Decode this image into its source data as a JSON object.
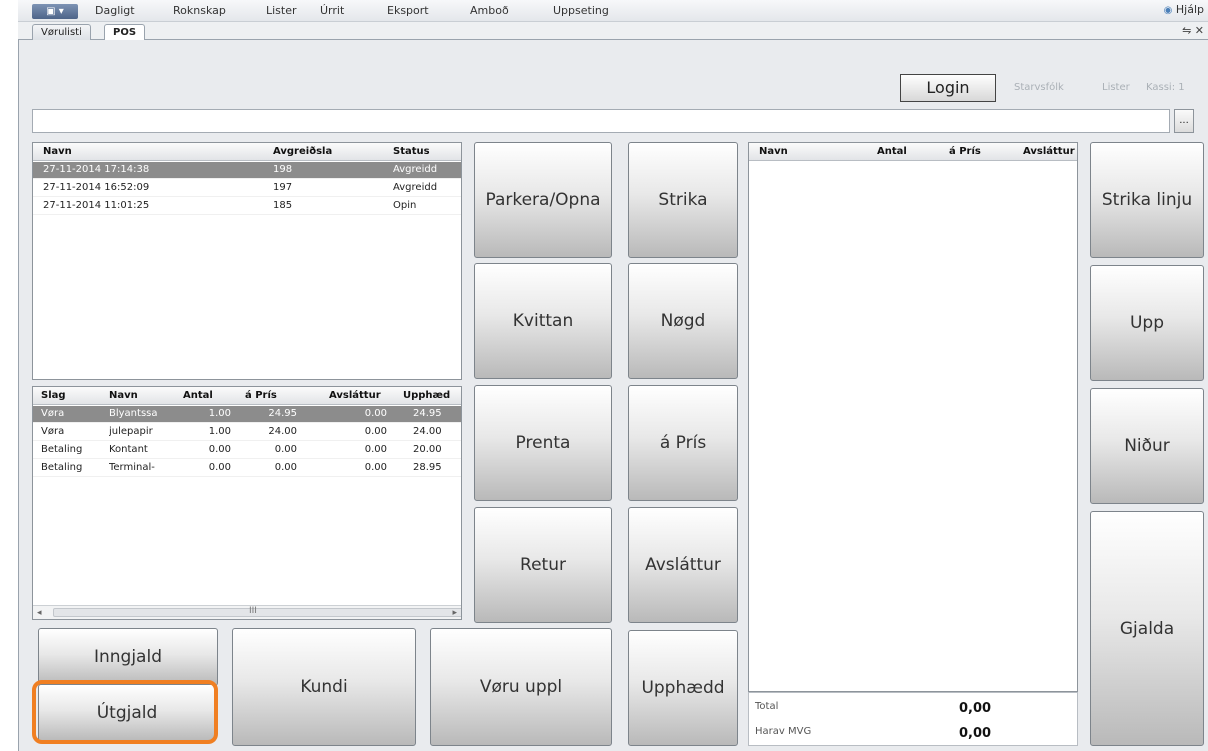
{
  "menubar": {
    "app_button": "▣ ▾",
    "items": [
      "Dagligt",
      "Roknskap",
      "Lister",
      "Úrrit",
      "Eksport",
      "Amboð",
      "Uppseting"
    ],
    "help": "Hjálp"
  },
  "tabs": [
    "Vørulisti",
    "POS"
  ],
  "tab_controls": "⇋ ✕",
  "header": {
    "login_label": "Login",
    "info_items": [
      "Starvsfólk",
      "Lister",
      "Kassi: 1"
    ]
  },
  "search": {
    "value": "",
    "ellipsis_label": "..."
  },
  "receipts_grid": {
    "columns": [
      "Navn",
      "Avgreiðsla",
      "Status"
    ],
    "rows": [
      [
        "27-11-2014 17:14:38",
        "198",
        "Avgreidd"
      ],
      [
        "27-11-2014 16:52:09",
        "197",
        "Avgreidd"
      ],
      [
        "27-11-2014 11:01:25",
        "185",
        "Opin"
      ]
    ]
  },
  "lines_grid": {
    "columns": [
      "Slag",
      "Navn",
      "Antal",
      "á Prís",
      "Avsláttur",
      "Upphæd"
    ],
    "rows": [
      [
        "Vøra",
        "Blyantssa",
        "1.00",
        "24.95",
        "0.00",
        "24.95"
      ],
      [
        "Vøra",
        "julepapir",
        "1.00",
        "24.00",
        "0.00",
        "24.00"
      ],
      [
        "Betaling",
        "Kontant",
        "0.00",
        "0.00",
        "0.00",
        "20.00"
      ],
      [
        "Betaling",
        "Terminal-",
        "0.00",
        "0.00",
        "0.00",
        "28.95"
      ]
    ],
    "scroll_glyph": "III"
  },
  "basket_grid": {
    "columns": [
      "Navn",
      "Antal",
      "á Prís",
      "Avsláttur"
    ]
  },
  "buttons": {
    "parkera": "Parkera/Opna",
    "strika": "Strika",
    "strika_linju": "Strika linju",
    "kvittan": "Kvittan",
    "nogd": "Nøgd",
    "upp": "Upp",
    "prenta": "Prenta",
    "a_pris": "á Prís",
    "nidur": "Niður",
    "retur": "Retur",
    "avslattur": "Avsláttur",
    "gjalda": "Gjalda",
    "inngjald": "Inngjald",
    "utgjald": "Útgjald",
    "kundi": "Kundi",
    "voru_uppl": "Vøru uppl",
    "upphaedd": "Upphædd"
  },
  "totals": {
    "total_label": "Total",
    "total_value": "0,00",
    "mvg_label": "Harav MVG",
    "mvg_value": "0,00"
  },
  "colors": {
    "highlight": "#f07f22",
    "selected_row": "#8c8c8c"
  }
}
